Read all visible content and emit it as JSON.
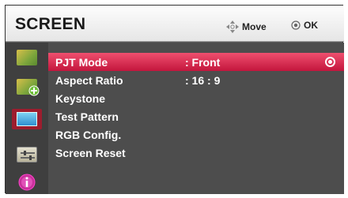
{
  "header": {
    "title": "SCREEN",
    "move_label": "Move",
    "ok_label": "OK"
  },
  "sidebar": {
    "items": [
      {
        "icon": "picture-icon"
      },
      {
        "icon": "picture-settings-icon"
      },
      {
        "icon": "screen-icon",
        "active": true
      },
      {
        "icon": "options-icon"
      },
      {
        "icon": "info-icon"
      }
    ]
  },
  "menu": {
    "items": [
      {
        "label": "PJT Mode",
        "value": ": Front",
        "selected": true
      },
      {
        "label": "Aspect Ratio",
        "value": ": 16 : 9"
      },
      {
        "label": "Keystone",
        "value": ""
      },
      {
        "label": "Test Pattern",
        "value": ""
      },
      {
        "label": "RGB Config.",
        "value": ""
      },
      {
        "label": "Screen Reset",
        "value": ""
      }
    ]
  },
  "colors": {
    "selected_row": "#d8284f",
    "menu_bg": "#4d4d4d",
    "sidebar_bg": "#3f3f3f",
    "header_bg": "#f2f2f2"
  }
}
